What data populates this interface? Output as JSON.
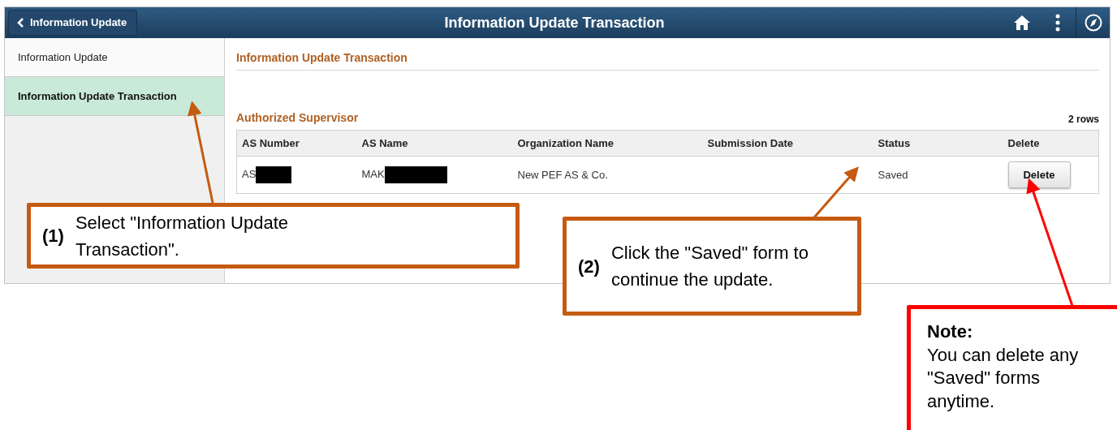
{
  "header": {
    "back_button": "Information Update",
    "title": "Information Update Transaction"
  },
  "sidebar": {
    "items": [
      {
        "label": "Information Update",
        "selected": false
      },
      {
        "label": "Information Update Transaction",
        "selected": true
      }
    ]
  },
  "content": {
    "page_title": "Information Update Transaction",
    "section_title": "Authorized Supervisor",
    "row_count": "2 rows",
    "table": {
      "columns": [
        "AS Number",
        "AS Name",
        "Organization Name",
        "Submission Date",
        "Status",
        "Delete"
      ],
      "rows": [
        {
          "as_number": {
            "text": "AS",
            "redacted": true
          },
          "as_name": {
            "text": "MAK",
            "redacted": true
          },
          "organization": "New PEF AS & Co.",
          "status": "Saved",
          "delete_button": "Delete"
        }
      ]
    }
  },
  "callouts": [
    {
      "kind": "step",
      "number": "(1)",
      "text": "Select \"Information Update Transaction\"."
    },
    {
      "kind": "step",
      "number": "(2)",
      "text": "Click the \"Saved\" form to continue the update."
    },
    {
      "kind": "note",
      "title": "Note:",
      "text": "You can delete any \"Saved\" forms anytime."
    }
  ]
}
